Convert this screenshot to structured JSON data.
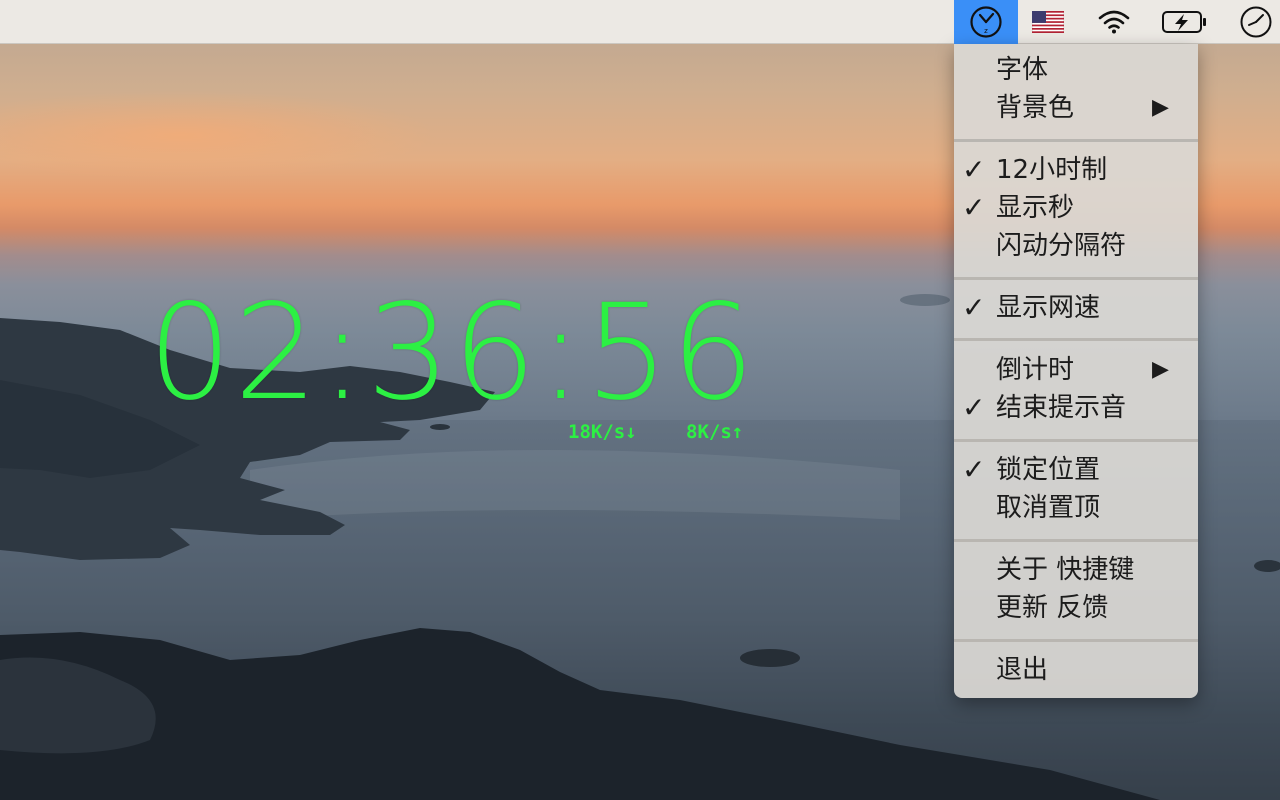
{
  "menubar": {
    "status_items": [
      {
        "icon": "clock-app-icon",
        "active": true
      },
      {
        "icon": "us-flag-icon",
        "active": false
      },
      {
        "icon": "wifi-icon",
        "active": false
      },
      {
        "icon": "battery-charging-icon",
        "active": false
      },
      {
        "icon": "clock-icon",
        "active": false
      }
    ]
  },
  "desktop": {
    "clock_time": "02:36:56",
    "download_speed": "18K/s↓",
    "upload_speed": "8K/s↑"
  },
  "menu": {
    "font": {
      "label": "字体"
    },
    "background_color": {
      "label": "背景色",
      "submenu_arrow": "▶"
    },
    "hour12": {
      "label": "12小时制",
      "checked": true
    },
    "show_seconds": {
      "label": "显示秒",
      "checked": true
    },
    "blink_separator": {
      "label": "闪动分隔符",
      "checked": false
    },
    "show_net_speed": {
      "label": "显示网速",
      "checked": true
    },
    "countdown": {
      "label": "倒计时",
      "submenu_arrow": "▶"
    },
    "end_sound": {
      "label": "结束提示音",
      "checked": true
    },
    "lock_position": {
      "label": "锁定位置",
      "checked": true
    },
    "cancel_on_top": {
      "label": "取消置顶",
      "checked": false
    },
    "about_shortcuts": {
      "label": "关于 快捷键"
    },
    "update_feedback": {
      "label": "更新 反馈"
    },
    "quit": {
      "label": "退出"
    },
    "checkmark": "✓"
  },
  "colors": {
    "clock_green": "#2cf043",
    "menubar_highlight": "#3a8ff7",
    "menu_background": "#dad8d4"
  }
}
